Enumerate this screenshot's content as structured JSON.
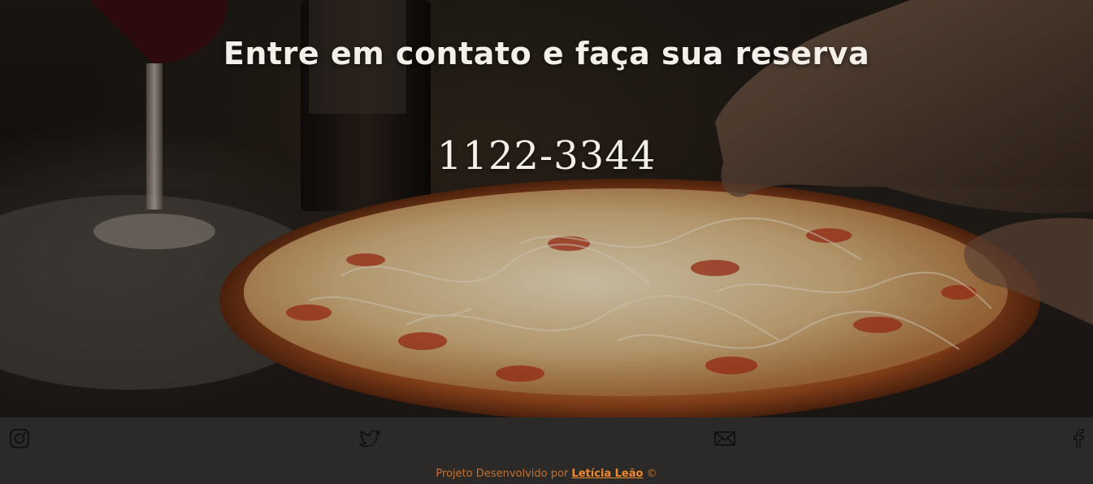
{
  "hero": {
    "title": "Entre em contato e faça sua reserva",
    "phone": "1122-3344",
    "image_description": "dark photo of a pizza with wine glass and bottle"
  },
  "footer": {
    "social": [
      {
        "name": "instagram",
        "icon": "instagram-icon"
      },
      {
        "name": "twitter",
        "icon": "twitter-icon"
      },
      {
        "name": "email",
        "icon": "mail-icon"
      },
      {
        "name": "facebook",
        "icon": "facebook-icon"
      }
    ],
    "credits_prefix": "Projeto Desenvolvido por",
    "author_name": "Letícia Leão",
    "credits_suffix": "©"
  },
  "colors": {
    "footer_bg": "#2b2a29",
    "icon_color": "#1a1a1a",
    "credits_text": "#c5702d",
    "author_link": "#f08a2e",
    "hero_text": "#f4efe8"
  }
}
